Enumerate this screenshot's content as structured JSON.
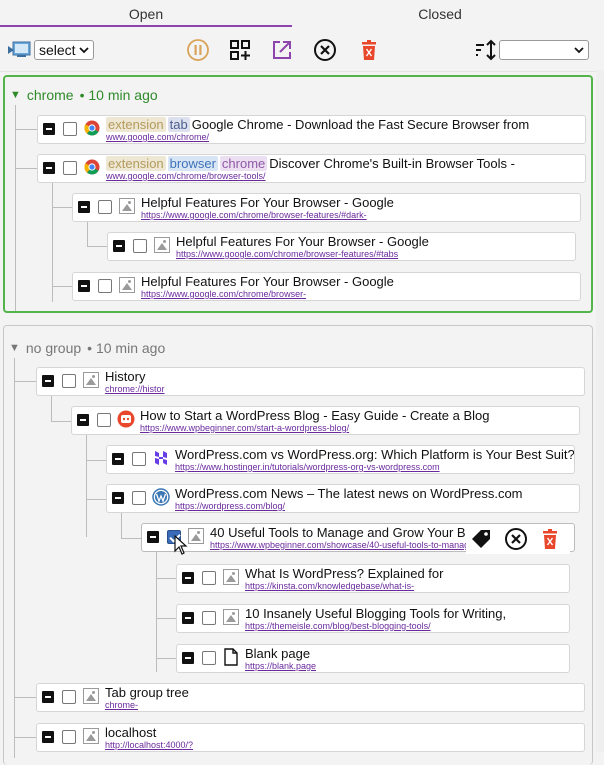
{
  "tabs": {
    "open": "Open",
    "closed": "Closed"
  },
  "toolbar": {
    "select": "select",
    "sort": ""
  },
  "colors": {
    "accent": "#8e44ad",
    "group_chrome": "#52b44b",
    "url": "#6a2a9e"
  },
  "groups": [
    {
      "name": "chrome",
      "meta": "• 10 min ago",
      "rows": [
        {
          "tags": [
            "extension",
            "tab"
          ],
          "title": "Google Chrome - Download the Fast Secure Browser from",
          "url": "www.google.com/chrome/",
          "icon": "chrome-icon"
        },
        {
          "tags": [
            "extension",
            "browser",
            "chrome"
          ],
          "title": "Discover Chrome's Built-in Browser Tools -",
          "url": "www.google.com/chrome/browser-tools/",
          "icon": "chrome-icon"
        },
        {
          "title": "Helpful Features For Your Browser - Google",
          "url": "https://www.google.com/chrome/browser-features/#dark-",
          "icon": "image-placeholder-icon"
        },
        {
          "title": "Helpful Features For Your Browser - Google",
          "url": "https://www.google.com/chrome/browser-features/#tabs",
          "icon": "image-placeholder-icon"
        },
        {
          "title": "Helpful Features For Your Browser - Google",
          "url": "https://www.google.com/chrome/browser-",
          "icon": "image-placeholder-icon"
        }
      ]
    },
    {
      "name": "no group",
      "meta": "• 10 min ago",
      "rows": [
        {
          "title": "History",
          "url": "chrome://histor",
          "icon": "image-placeholder-icon"
        },
        {
          "title": "How to Start a WordPress Blog - Easy Guide - Create a Blog",
          "url": "https://www.wpbeginner.com/start-a-wordpress-blog/",
          "icon": "wpbeginner-icon"
        },
        {
          "title": "WordPress.com vs WordPress.org: Which Platform is Your Best Suit?",
          "url": "https://www.hostinger.in/tutorials/wordpress-org-vs-wordpress.com",
          "icon": "hostinger-icon"
        },
        {
          "title": "WordPress.com News – The latest news on WordPress.com",
          "url": "https://wordpress.com/blog/",
          "icon": "wordpress-icon"
        },
        {
          "title": "40 Useful Tools to Manage and Grow Your B",
          "url": "https://www.wpbeginner.com/showcase/40-useful-tools-to-manage",
          "icon": "image-placeholder-icon"
        },
        {
          "title": "What Is WordPress? Explained for",
          "url": "https://kinsta.com/knowledgebase/what-is-",
          "icon": "image-placeholder-icon"
        },
        {
          "title": "10 Insanely Useful Blogging Tools for Writing,",
          "url": "https://themeisle.com/blog/best-blogging-tools/",
          "icon": "image-placeholder-icon"
        },
        {
          "title": "Blank page",
          "url": "https://blank.page",
          "icon": "page-icon"
        },
        {
          "title": "Tab group tree",
          "url": "chrome-",
          "icon": "image-placeholder-icon"
        },
        {
          "title": "localhost",
          "url": "http://localhost:4000/?",
          "icon": "image-placeholder-icon"
        }
      ]
    }
  ]
}
